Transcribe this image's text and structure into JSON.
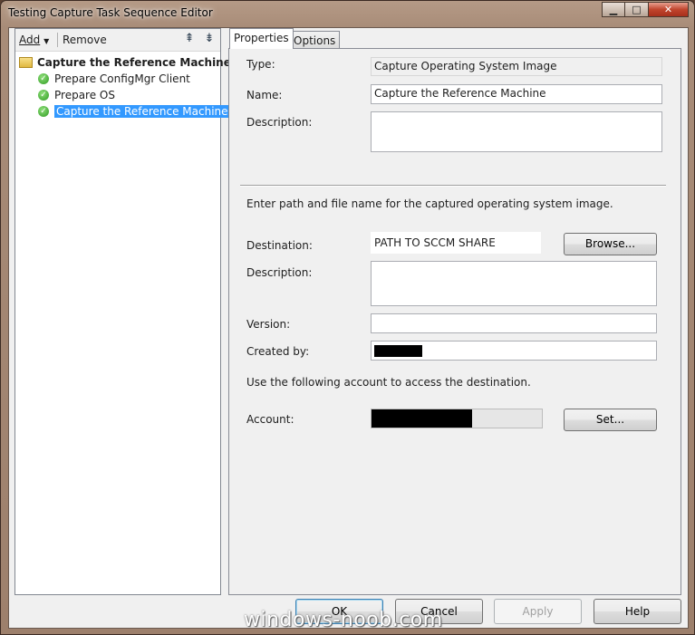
{
  "window": {
    "title": "Testing Capture Task Sequence Editor"
  },
  "toolbar": {
    "add_label": "Add",
    "remove_label": "Remove"
  },
  "tree": {
    "root": "Capture the Reference Machine",
    "items": [
      {
        "label": "Prepare ConfigMgr Client"
      },
      {
        "label": "Prepare OS"
      },
      {
        "label": "Capture the Reference Machine",
        "selected": true
      }
    ]
  },
  "tabs": [
    {
      "label": "Properties",
      "active": true
    },
    {
      "label": "Options"
    }
  ],
  "properties": {
    "type_label": "Type:",
    "type_value": "Capture Operating System Image",
    "name_label": "Name:",
    "name_value": "Capture the Reference Machine",
    "description_label": "Description:",
    "description_value": "",
    "path_instruction": "Enter path and file name for the captured operating system image.",
    "destination_label": "Destination:",
    "destination_value": "PATH TO SCCM SHARE",
    "browse_button": "Browse...",
    "image_description_label": "Description:",
    "image_description_value": "",
    "version_label": "Version:",
    "version_value": "",
    "created_by_label": "Created by:",
    "account_instruction": "Use the following account to access the destination.",
    "account_label": "Account:",
    "set_button": "Set..."
  },
  "buttons": {
    "ok": "OK",
    "cancel": "Cancel",
    "apply": "Apply",
    "help": "Help"
  },
  "watermark": "windows-noob.com"
}
